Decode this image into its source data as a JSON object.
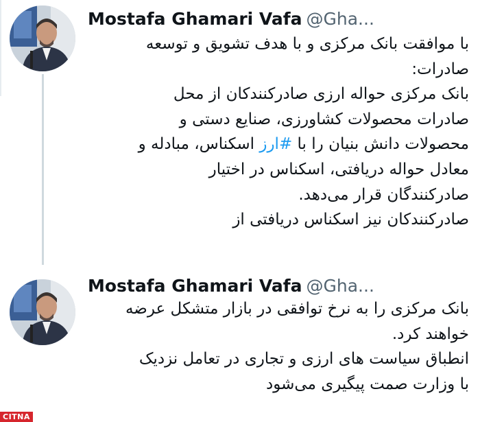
{
  "tweets": [
    {
      "author": {
        "name": "Mostafa Ghamari Vafa",
        "handle": "@Gha..."
      },
      "lines": [
        "با موافقت بانک مرکزی و با هدف تشویق و توسعه",
        "صادرات:",
        "بانک مرکزی حواله ارزی صادرکنندکان از محل",
        "صادرات محصولات کشاورزی، صنایع دستی و",
        {
          "before": "محصولات دانش بنیان را با ",
          "hashtag": "#ارز",
          "after": " اسکناس، مبادله و"
        },
        "معادل حواله دریافتی، اسکناس در اختیار",
        "صادرکنندگان قرار می‌دهد.",
        "صادرکنندکان نیز اسکناس دریافتی از"
      ]
    },
    {
      "author": {
        "name": "Mostafa Ghamari Vafa",
        "handle": "@Gha..."
      },
      "lines": [
        "بانک مرکزی را به نرخ توافقی در بازار متشکل عرضه",
        "خواهند کرد.",
        "انطباق سیاست های ارزی و تجاری در تعامل نزدیک",
        "با وزارت صمت پیگیری می‌شود"
      ]
    }
  ],
  "watermark": {
    "text": "CITNA"
  },
  "colors": {
    "hashtag": "#1d9bf0",
    "handle": "#536471",
    "thread_line": "#cfd9de",
    "watermark": "#d6262d"
  }
}
